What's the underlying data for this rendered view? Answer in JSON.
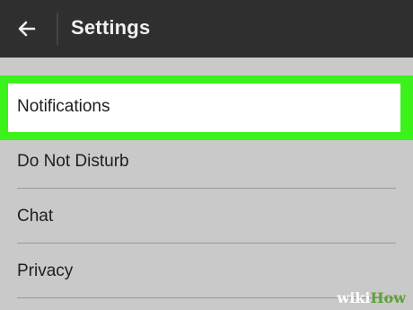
{
  "appbar": {
    "back_icon": "arrow-left-icon",
    "title": "Settings"
  },
  "settings": {
    "items": [
      {
        "label": "Notifications",
        "highlighted": true
      },
      {
        "label": "Do Not Disturb",
        "highlighted": false
      },
      {
        "label": "Chat",
        "highlighted": false
      },
      {
        "label": "Privacy",
        "highlighted": false
      }
    ]
  },
  "watermark": {
    "wiki": "wiki",
    "how": "How"
  },
  "colors": {
    "appbar_bg": "#2f2f2f",
    "list_bg": "#c9c9c9",
    "highlight_border": "#3cf21b",
    "watermark_how": "#5fa038"
  }
}
